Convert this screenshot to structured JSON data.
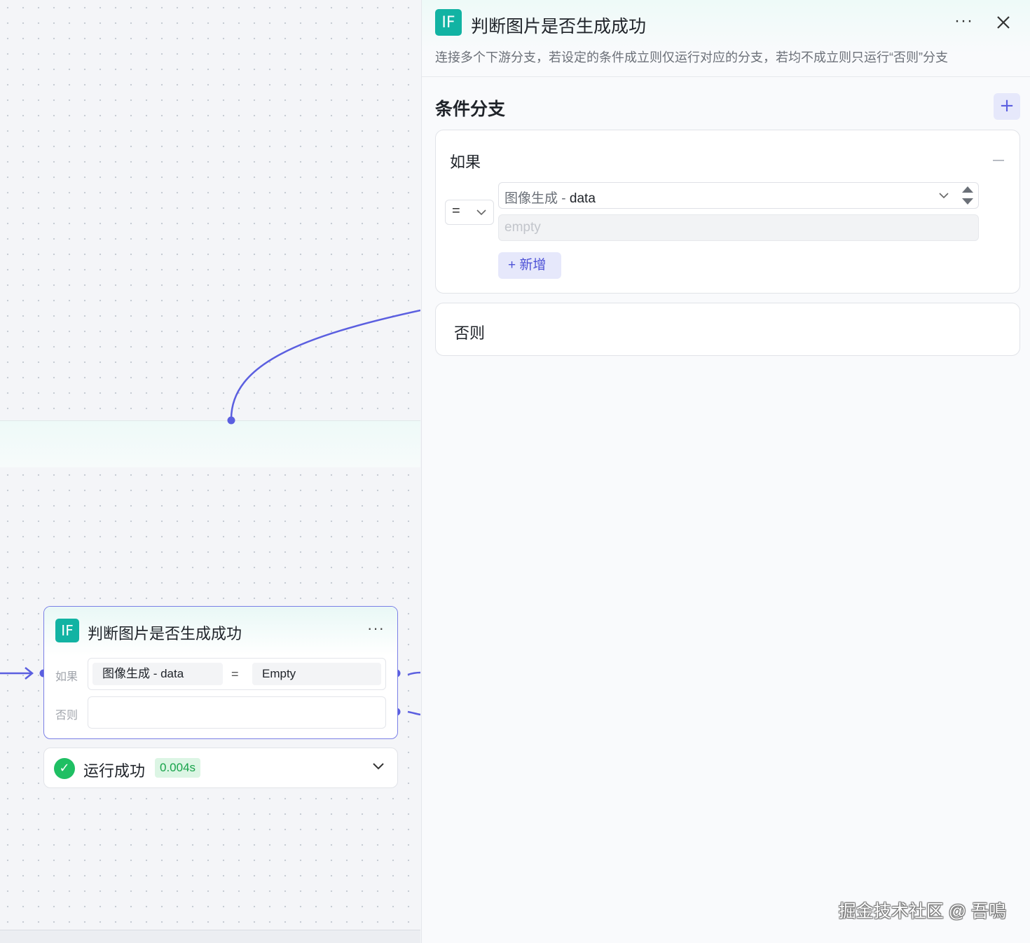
{
  "canvas": {
    "node": {
      "badge": "IF",
      "title": "判断图片是否生成成功",
      "more": "···",
      "if_label": "如果",
      "else_label": "否则",
      "condition": {
        "variable": "图像生成 - data",
        "operator": "=",
        "value": "Empty"
      }
    },
    "status": {
      "text": "运行成功",
      "time": "0.004s"
    }
  },
  "panel": {
    "badge": "IF",
    "title": "判断图片是否生成成功",
    "more": "···",
    "description": "连接多个下游分支，若设定的条件成立则仅运行对应的分支，若均不成立则只运行“否则”分支",
    "section_title": "条件分支",
    "add_branch": "+",
    "if_branch": {
      "label": "如果",
      "operator": "=",
      "variable_source": "图像生成",
      "variable_sep": " - ",
      "variable_field": "data",
      "value_placeholder": "empty",
      "add_condition": "+ 新增"
    },
    "else_branch": {
      "label": "否则"
    }
  },
  "watermark": "掘金技术社区 @ 吾鳴",
  "colors": {
    "accent": "#5b5fe0",
    "if_badge": "#12b3a3",
    "success": "#1fbf63"
  }
}
